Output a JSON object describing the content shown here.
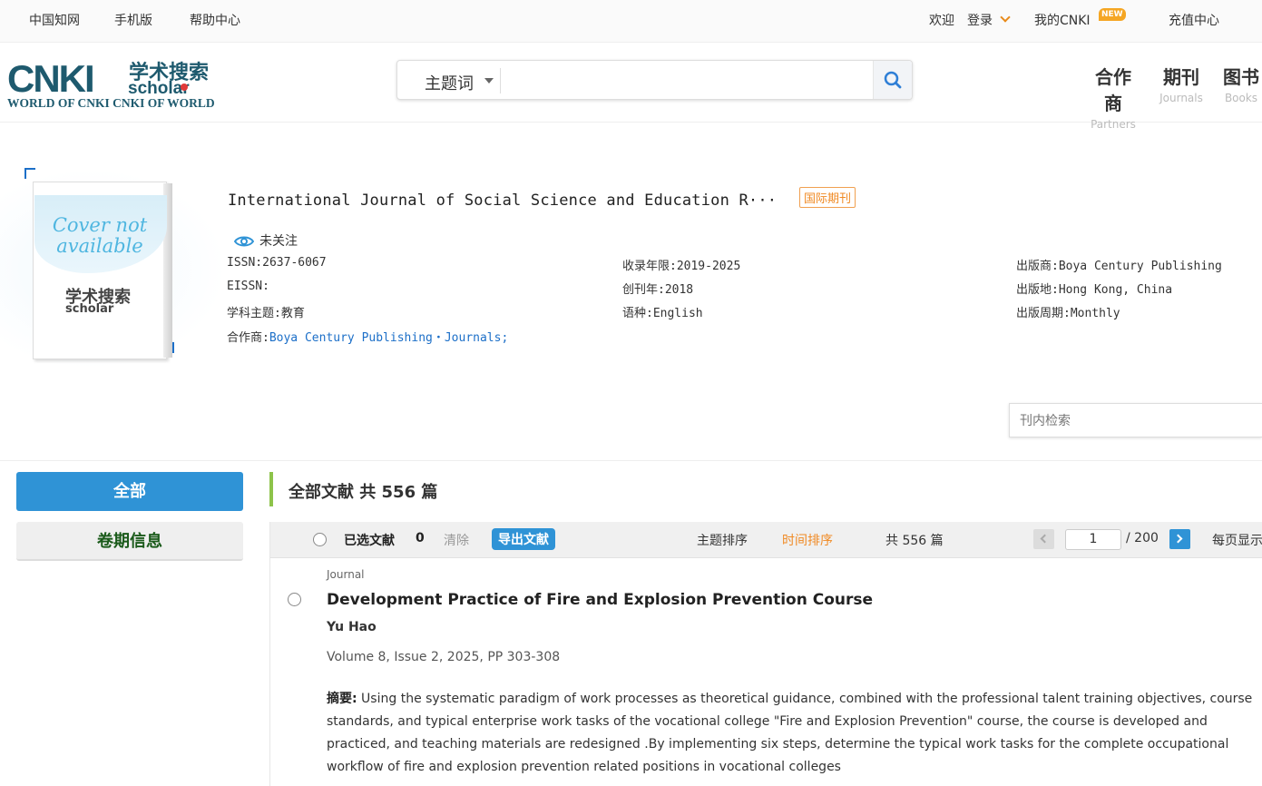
{
  "topbar": {
    "cnki": "中国知网",
    "mobile": "手机版",
    "help": "帮助中心",
    "welcome": "欢迎",
    "login": "登录",
    "mycnki": "我的CNKI",
    "new_badge": "NEW",
    "recharge": "充值中心"
  },
  "logo": {
    "main": "CNKI",
    "cn": "学术搜索",
    "sub": "scholar",
    "tagline": "WORLD OF CNKI CNKI OF WORLD"
  },
  "search": {
    "field": "主题词",
    "value": "",
    "icon": "search-icon"
  },
  "nav": [
    {
      "cn": "合作商",
      "en": "Partners"
    },
    {
      "cn": "期刊",
      "en": "Journals"
    },
    {
      "cn": "图书",
      "en": "Books"
    }
  ],
  "cover": {
    "text": "Cover not available",
    "logo_cn": "学术搜索",
    "logo_en": "scholar"
  },
  "journal": {
    "title": "International Journal of Social Science and Education R···",
    "badge": "国际期刊",
    "follow": "未关注",
    "issn": "ISSN:2637-6067",
    "eissn": "EISSN:",
    "subject": "学科主题:教育",
    "partner_label": "合作商:",
    "partner_link": "Boya Century Publishing・Journals;",
    "years": "收录年限:2019-2025",
    "founded": "创刊年:2018",
    "language": "语种:English",
    "publisher": "出版商:Boya Century Publishing",
    "location": "出版地:Hong Kong, China",
    "frequency": "出版周期:Monthly"
  },
  "inner_search": {
    "placeholder": "刊内检索"
  },
  "sidebar": {
    "all": "全部",
    "issues": "卷期信息"
  },
  "main": {
    "heading": "全部文献 共 556 篇"
  },
  "toolbar": {
    "selected_label": "已选文献",
    "selected_count": "0",
    "clear": "清除",
    "export": "导出文献",
    "sort_topic": "主题排序",
    "sort_time": "时间排序",
    "total": "共 556 篇",
    "page": "1",
    "page_total": "/ 200",
    "per_page": "每页显示"
  },
  "colors": {
    "accent": "#2f93d6",
    "sort_active": "#f08a24",
    "green_bar": "#8dc34a",
    "badge_orange": "#f08a24"
  },
  "article": {
    "type": "Journal",
    "title": "Development Practice of Fire and Explosion Prevention Course",
    "author": "Yu Hao",
    "volume": "Volume 8, Issue 2, 2025, PP 303-308",
    "abstract_label": "摘要:",
    "abstract": " Using the systematic paradigm of work processes as theoretical guidance, combined with the professional talent training objectives, course standards, and typical enterprise work tasks of the vocational college \"Fire and Explosion Prevention\" course, the course is developed and practiced, and teaching materials are redesigned .By implementing six steps, determine the typical work tasks for the complete occupational workflow of fire and explosion prevention related positions in vocational colleges"
  }
}
